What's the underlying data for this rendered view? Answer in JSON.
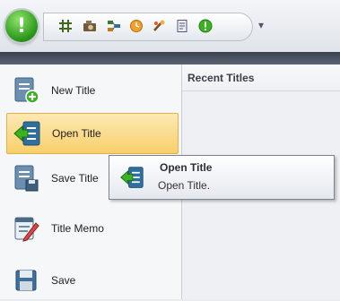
{
  "toolbar": {
    "more_glyph": "▾"
  },
  "menu": {
    "items": [
      {
        "label": "New Title"
      },
      {
        "label": "Open Title"
      },
      {
        "label": "Save Title"
      },
      {
        "label": "Title Memo"
      },
      {
        "label": "Save"
      }
    ]
  },
  "recent": {
    "heading": "Recent Titles"
  },
  "tooltip": {
    "title": "Open Title",
    "description": "Open Title."
  },
  "colors": {
    "orb_green": "#2e9b1c",
    "menu_active": "#f8cf6a"
  }
}
